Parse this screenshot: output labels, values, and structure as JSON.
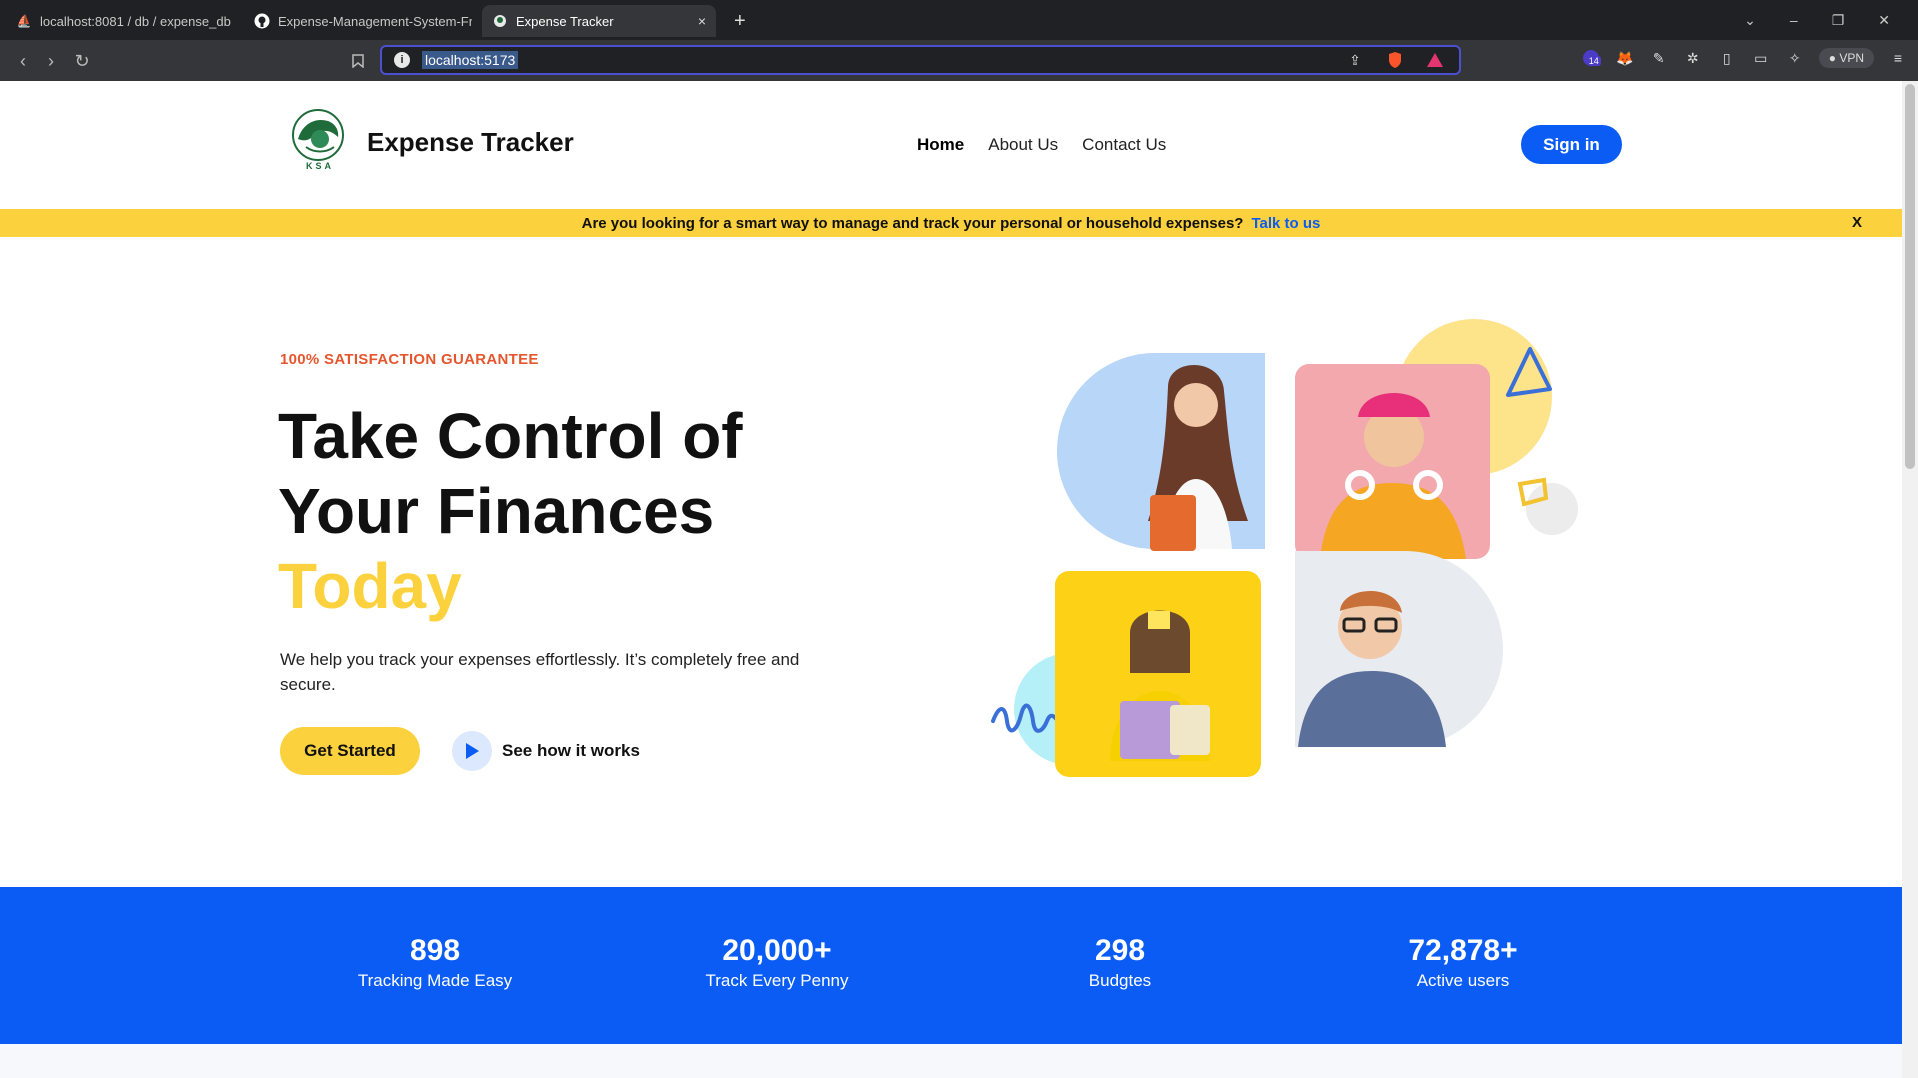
{
  "browser": {
    "tabs": [
      {
        "title": "localhost:8081 / db / expense_db / ..."
      },
      {
        "title": "Expense-Management-System-Fron"
      },
      {
        "title": "Expense Tracker"
      }
    ],
    "new_tab": "+",
    "tab_close": "×",
    "window_controls": {
      "dropdown": "⌄",
      "minimize": "–",
      "restore": "❐",
      "close": "✕"
    },
    "url": "localhost:5173",
    "extension_badge": "14",
    "vpn_label": "VPN"
  },
  "site": {
    "brand": "Expense Tracker",
    "logo_caption": "KSA",
    "nav": [
      {
        "label": "Home"
      },
      {
        "label": "About Us"
      },
      {
        "label": "Contact Us"
      }
    ],
    "signin_label": "Sign in",
    "banner": {
      "text": "Are you looking for a smart way to manage and track your personal or household expenses?",
      "link": "Talk to us",
      "close": "X"
    },
    "hero": {
      "eyebrow": "100% SATISFACTION GUARANTEE",
      "title_line1": "Take Control of",
      "title_line2": "Your Finances",
      "title_accent": "Today",
      "description": "We help you track your expenses effortlessly. It’s completely free and secure.",
      "cta_label": "Get Started",
      "howto_label": "See how it works"
    },
    "stats": [
      {
        "value": "898",
        "label": "Tracking Made Easy"
      },
      {
        "value": "20,000+",
        "label": "Track Every Penny"
      },
      {
        "value": "298",
        "label": "Budgtes"
      },
      {
        "value": "72,878+",
        "label": "Active users"
      }
    ]
  },
  "colors": {
    "brand_blue": "#0a5cf5",
    "accent_yellow": "#fbd13d",
    "eyebrow_orange": "#e4572e"
  }
}
